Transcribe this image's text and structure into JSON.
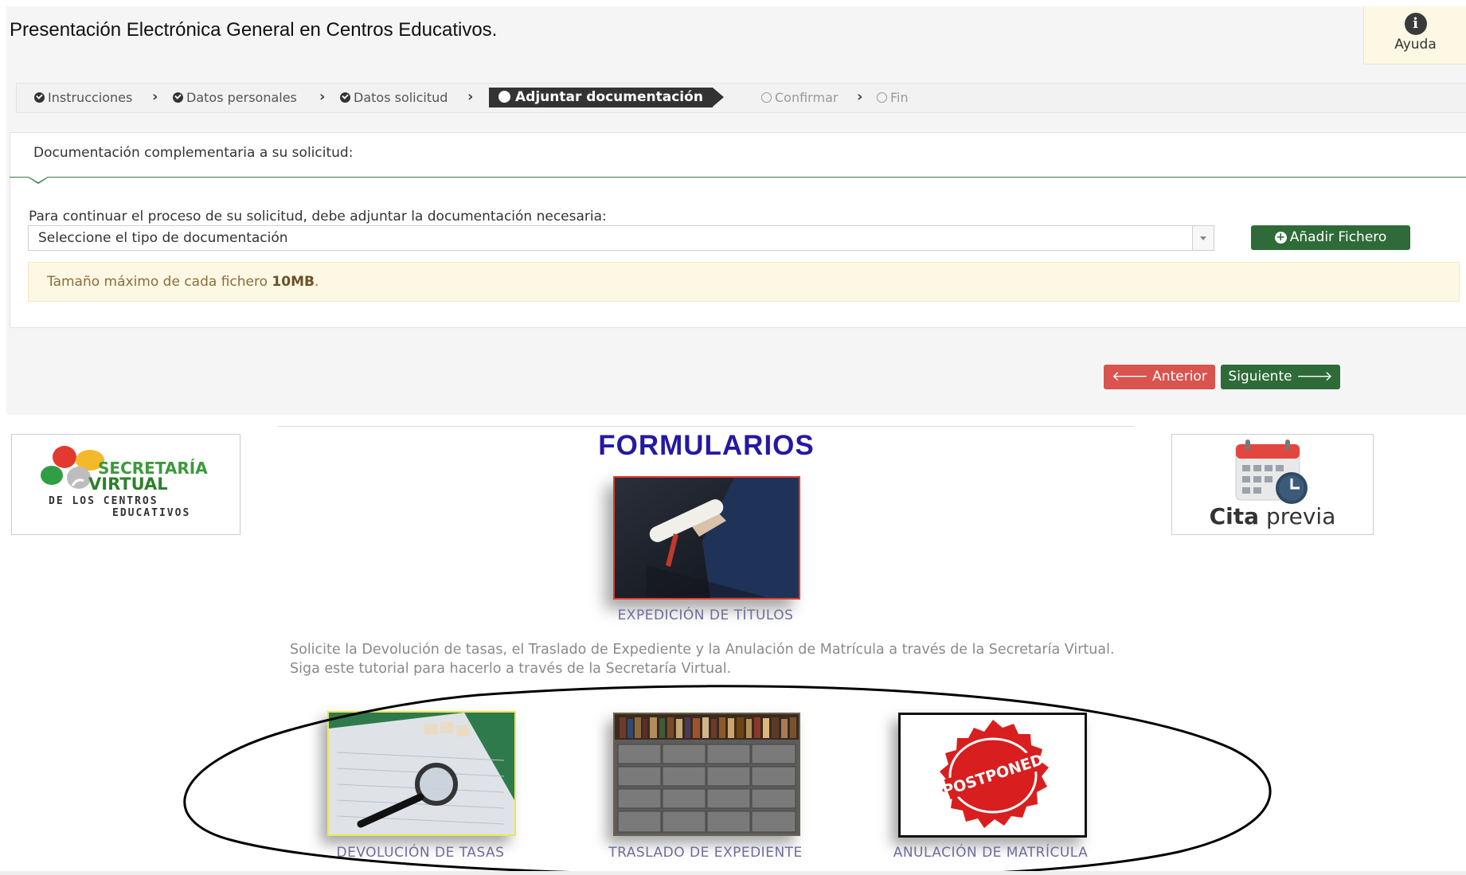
{
  "header": {
    "title": "Presentación Electrónica General en Centros Educativos.",
    "help_label": "Ayuda"
  },
  "wizard": {
    "steps": [
      {
        "label": "Instrucciones",
        "state": "done"
      },
      {
        "label": "Datos personales",
        "state": "done"
      },
      {
        "label": "Datos solicitud",
        "state": "done"
      },
      {
        "label": "Adjuntar documentación",
        "state": "active"
      },
      {
        "label": "Confirmar",
        "state": "pending"
      },
      {
        "label": "Fin",
        "state": "pending"
      }
    ]
  },
  "panel": {
    "heading": "Documentación complementaria a su solicitud:",
    "instruction": "Para continuar el proceso de su solicitud, debe adjuntar la documentación necesaria:",
    "select_value": "Seleccione el tipo de documentación",
    "add_button": "Añadir Fichero",
    "alert_text": "Tamaño máximo de cada fichero ",
    "alert_strong": "10MB",
    "alert_end": "."
  },
  "nav": {
    "prev": "Anterior",
    "next": "Siguiente"
  },
  "site": {
    "section_title": "FORMULARIOS",
    "sv_logo": {
      "line1": "SECRETARÍA",
      "line2": "VIRTUAL",
      "line3": "DE LOS CENTROS",
      "line4": "EDUCATIVOS"
    },
    "cita": {
      "bold": "Cita",
      "rest": " previa"
    },
    "titulos_caption": "EXPEDICIÓN DE TÍTULOS",
    "intro": "Solicite la Devolución de tasas, el Traslado de Expediente y la Anulación de Matrícula a través de la Secretaría Virtual. Siga este tutorial para hacerlo a través de la Secretaría Virtual.",
    "forms": [
      {
        "caption": "DEVOLUCIÓN DE TASAS"
      },
      {
        "caption": "TRASLADO DE EXPEDIENTE"
      },
      {
        "caption": "ANULACIÓN DE MATRÍCULA",
        "stamp_text": "POSTPONED"
      }
    ]
  },
  "colors": {
    "success": "#2e6b38",
    "danger": "#d9534f",
    "title_blue": "#2418a4",
    "annotation": "#000000"
  }
}
